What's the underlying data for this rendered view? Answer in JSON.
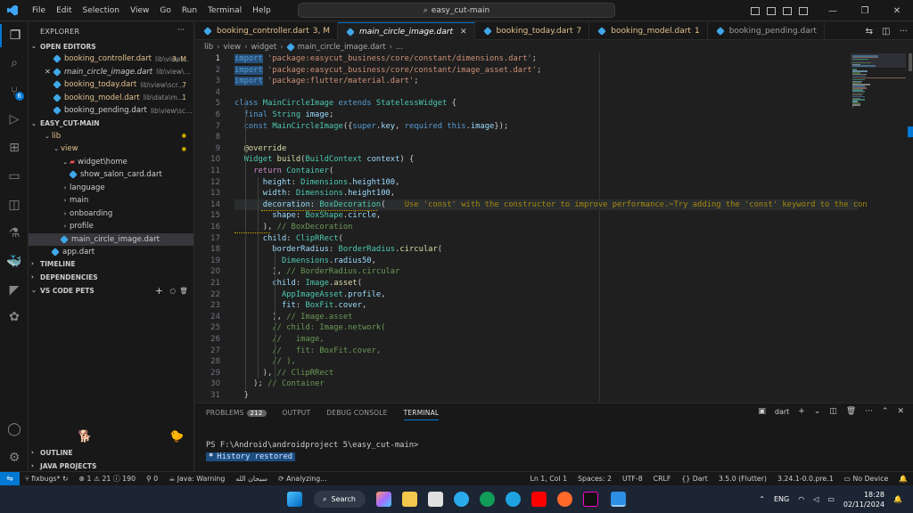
{
  "menu": [
    "File",
    "Edit",
    "Selection",
    "View",
    "Go",
    "Run",
    "Terminal",
    "Help"
  ],
  "command_center": "easy_cut-main",
  "explorer": {
    "title": "EXPLORER",
    "open_editors_label": "OPEN EDITORS",
    "open_editors": [
      {
        "name": "booking_controller.dart",
        "path": "lib\\view\\...",
        "mod": "3, M"
      },
      {
        "name": "main_circle_image.dart",
        "path": "lib\\view\\widget...",
        "mod": ""
      },
      {
        "name": "booking_today.dart",
        "path": "lib\\view\\scr...",
        "mod": "7"
      },
      {
        "name": "booking_model.dart",
        "path": "lib\\data\\m...",
        "mod": "1"
      },
      {
        "name": "booking_pending.dart",
        "path": "lib\\view\\scree...",
        "mod": ""
      }
    ],
    "project_label": "EASY_CUT-MAIN",
    "tree": [
      {
        "label": "lib",
        "indent": 1,
        "type": "folder-open",
        "color": "y"
      },
      {
        "label": "view",
        "indent": 2,
        "type": "folder-open",
        "color": "y"
      },
      {
        "label": "widget\\home",
        "indent": 3,
        "type": "folder-open-red",
        "color": ""
      },
      {
        "label": "show_salon_card.dart",
        "indent": 4,
        "type": "file",
        "color": ""
      },
      {
        "label": "language",
        "indent": 3,
        "type": "folder",
        "color": ""
      },
      {
        "label": "main",
        "indent": 3,
        "type": "folder",
        "color": ""
      },
      {
        "label": "onboarding",
        "indent": 3,
        "type": "folder",
        "color": ""
      },
      {
        "label": "profile",
        "indent": 3,
        "type": "folder",
        "color": ""
      },
      {
        "label": "main_circle_image.dart",
        "indent": 3,
        "type": "file-sel",
        "color": ""
      },
      {
        "label": "app.dart",
        "indent": 2,
        "type": "file",
        "color": ""
      }
    ],
    "timeline": "TIMELINE",
    "dependencies": "DEPENDENCIES",
    "pets": "VS CODE PETS",
    "outline": "OUTLINE",
    "java_projects": "JAVA PROJECTS"
  },
  "tabs": [
    {
      "name": "booking_controller.dart",
      "mod": "3, M",
      "active": false
    },
    {
      "name": "main_circle_image.dart",
      "mod": "",
      "active": true
    },
    {
      "name": "booking_today.dart",
      "mod": "7",
      "active": false
    },
    {
      "name": "booking_model.dart",
      "mod": "1",
      "active": false
    },
    {
      "name": "booking_pending.dart",
      "mod": "",
      "active": false
    }
  ],
  "breadcrumb": [
    "lib",
    "view",
    "widget",
    "main_circle_image.dart",
    "..."
  ],
  "code_lines": [
    "<span class=\"kw selbg\">import</span> <span class=\"str\">'package:easycut_business/core/constant/dimensions.dart'</span>;",
    "<span class=\"kw selbg\">import</span> <span class=\"str\">'package:easycut_business/core/constant/image_asset.dart'</span>;",
    "<span class=\"kw selbg\">import</span> <span class=\"str\">'package:flutter/material.dart'</span>;",
    "",
    "<span class=\"kw\">class</span> <span class=\"ty\">MainCircleImage</span> <span class=\"kw\">extends</span> <span class=\"ty\">StatelessWidget</span> {",
    "  <span class=\"kw\">final</span> <span class=\"ty\">String</span> <span class=\"pr\">image</span>;",
    "  <span class=\"kw\">const</span> <span class=\"ty\">MainCircleImage</span>({<span class=\"kw\">super</span>.<span class=\"pr\">key</span>, <span class=\"kw\">required</span> <span class=\"kw\">this</span>.<span class=\"pr\">image</span>});",
    "",
    "  <span class=\"fn\">@override</span>",
    "  <span class=\"ty\">Widget</span> <span class=\"fn\">build</span>(<span class=\"ty\">BuildContext</span> <span class=\"pr\">context</span>) {",
    "    <span class=\"ctl\">return</span> <span class=\"ty\">Container</span>(",
    "      <span class=\"pr\">height</span>: <span class=\"ty\">Dimensions</span>.<span class=\"pr\">height100</span>,",
    "      <span class=\"pr\">width</span>: <span class=\"ty\">Dimensions</span>.<span class=\"pr\">height100</span>,",
    "      <span class=\"pr\">decoration</span>: <span class=\"ty\">BoxDecoration</span>(    <span class=\"hint\">Use 'const' with the constructor to improve performance.✂Try adding the 'const' keyword to the con</span>",
    "        <span class=\"pr\">shape</span>: <span class=\"ty\">BoxShape</span>.<span class=\"pr\">circle</span>,",
    "      ), <span class=\"cm\">// BoxDecoration</span>",
    "      <span class=\"pr\">child</span>: <span class=\"ty\">ClipRRect</span>(",
    "        <span class=\"pr\">borderRadius</span>: <span class=\"ty\">BorderRadius</span>.<span class=\"fn\">circular</span>(",
    "          <span class=\"ty\">Dimensions</span>.<span class=\"pr\">radius50</span>,",
    "        ), <span class=\"cm\">// BorderRadius.circular</span>",
    "        <span class=\"pr\">child</span>: <span class=\"ty\">Image</span>.<span class=\"fn\">asset</span>(",
    "          <span class=\"ty\">AppImageAsset</span>.<span class=\"pr\">profile</span>,",
    "          <span class=\"pr\">fit</span>: <span class=\"ty\">BoxFit</span>.<span class=\"pr\">cover</span>,",
    "        ), <span class=\"cm\">// Image.asset</span>",
    "        <span class=\"cm\">// child: Image.network(</span>",
    "        <span class=\"cm\">//   image,</span>",
    "        <span class=\"cm\">//   fit: BoxFit.cover,</span>",
    "        <span class=\"cm\">// ),</span>",
    "      ), <span class=\"cm\">// ClipRRect</span>",
    "    ); <span class=\"cm\">// Container</span>",
    "  }"
  ],
  "panel": {
    "tabs": [
      "PROBLEMS",
      "OUTPUT",
      "DEBUG CONSOLE",
      "TERMINAL"
    ],
    "problems_count": "212",
    "terminal_name": "dart",
    "prompt": "PS F:\\Android\\androidproject 5\\easy_cut-main>",
    "history": "History restored",
    "history_mark": "*"
  },
  "status": {
    "branch": "fixbugs*",
    "errors": "1",
    "warnings": "21",
    "infos": "190",
    "ports": "0",
    "java": "Java: Warning",
    "arabic": "سبحان الله",
    "analyzing": "Analyzing...",
    "position": "Ln 1, Col 1",
    "spaces": "Spaces: 2",
    "encoding": "UTF-8",
    "eol": "CRLF",
    "lang": "Dart",
    "sdk": "3.5.0 (Flutter)",
    "flutter": "3.24.1-0.0.pre.1",
    "device": "No Device"
  },
  "taskbar": {
    "search": "Search",
    "lang": "ENG",
    "time": "18:28",
    "date": "02/11/2024"
  },
  "colors": {
    "accent": "#0078d4",
    "editor_bg": "#1f1f1f",
    "sidebar_bg": "#181818",
    "taskbar_bg": "#1c2533"
  }
}
